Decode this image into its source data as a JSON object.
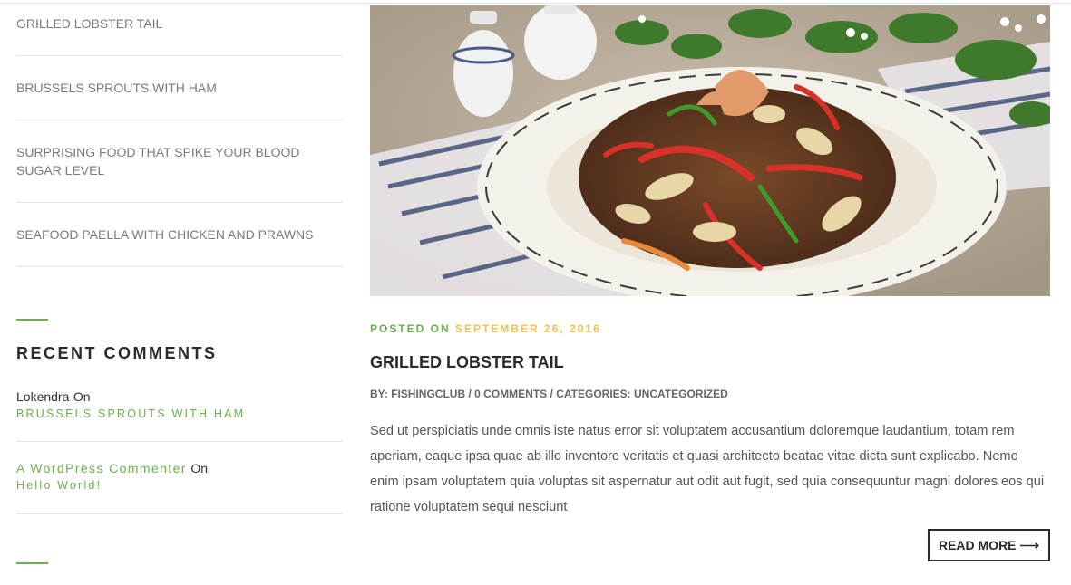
{
  "recent_posts": [
    {
      "title": "Grilled Lobster Tail"
    },
    {
      "title": "Brussels Sprouts With Ham"
    },
    {
      "title": "Surprising Food That Spike Your Blood Sugar Level"
    },
    {
      "title": "Seafood Paella With Chicken And Prawns"
    }
  ],
  "recent_comments": {
    "title": "Recent Comments",
    "items": [
      {
        "author": "Lokendra",
        "on": "On",
        "post": "Brussels Sprouts With Ham"
      },
      {
        "author": "A WordPress Commenter",
        "on": "On",
        "post": "Hello World!"
      }
    ]
  },
  "post": {
    "image_alt": "stir-fried noodles with vegetables on a white plate",
    "posted_label": "Posted On",
    "date": "September 26, 2016",
    "title": "Grilled Lobster Tail",
    "meta": {
      "by_label": "By:",
      "author": "fishingclub",
      "separator": "/",
      "comments": "0 Comments",
      "categories_label": "Categories:",
      "category": "Uncategorized"
    },
    "excerpt": "Sed ut perspiciatis unde omnis iste natus error sit voluptatem accusantium doloremque laudantium, totam rem aperiam, eaque ipsa quae ab illo inventore veritatis et quasi architecto beatae vitae dicta sunt explicabo. Nemo enim ipsam voluptatem quia voluptas sit aspernatur aut odit aut fugit, sed quia consequuntur magni dolores eos qui ratione voluptatem sequi nesciunt",
    "read_more": "Read More",
    "read_more_icon": "arrow-right-icon"
  },
  "colors": {
    "accent_green": "#6ab04c",
    "date_yellow": "#f5c04a",
    "heading": "#2a2a2a",
    "muted_text": "#7a7a7a"
  }
}
